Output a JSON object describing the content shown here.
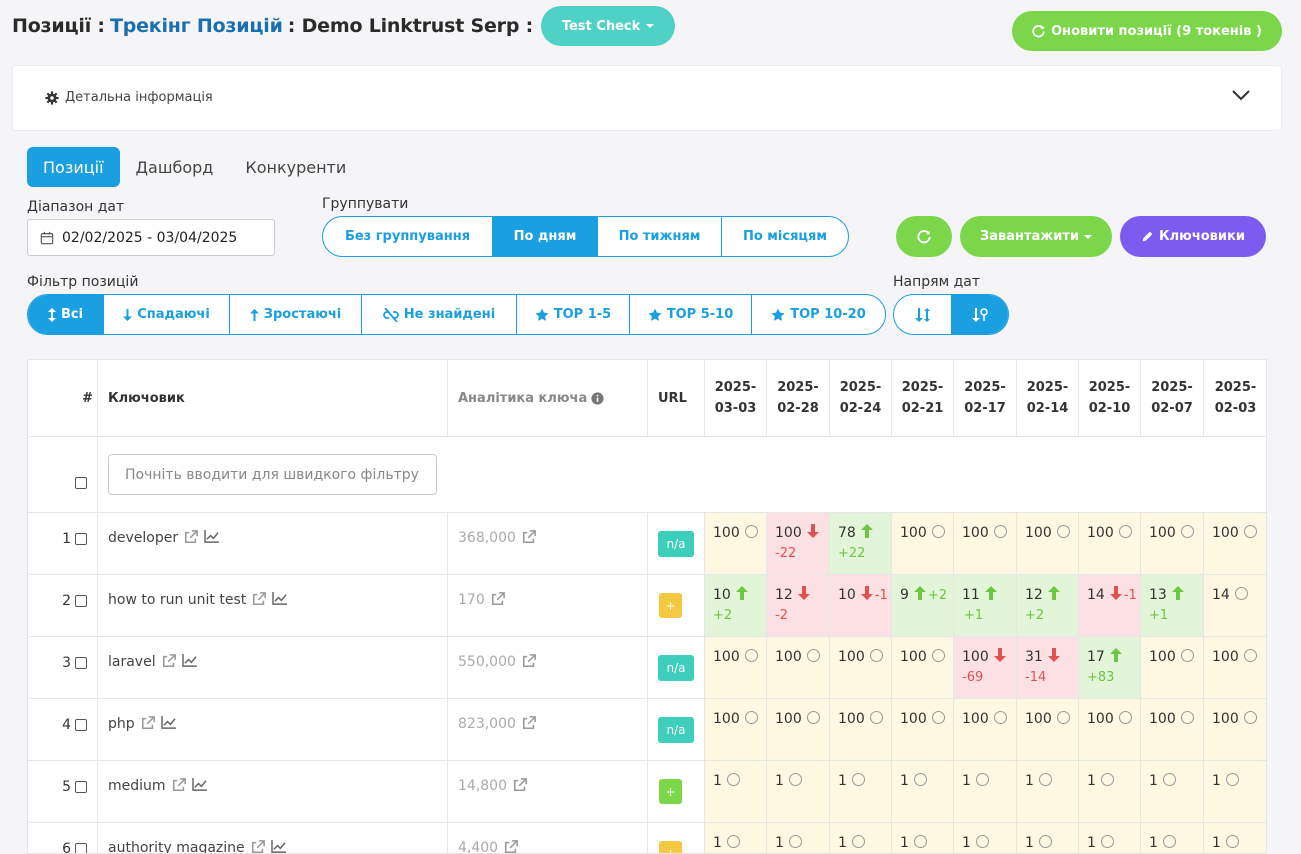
{
  "header": {
    "title1": "Позиції :",
    "title2": "Трекінг Позицій",
    "title3": ": Demo Linktrust Serp :",
    "project_btn": "Test Check",
    "update_btn": "Оновити позиції (9 токенів )"
  },
  "detail": {
    "label": "Детальна інформація"
  },
  "tabs": [
    "Позиції",
    "Дашборд",
    "Конкуренти"
  ],
  "date_range": {
    "label": "Діапазон дат",
    "value": "02/02/2025 - 03/04/2025"
  },
  "group": {
    "label": "Группувати",
    "options": [
      "Без группування",
      "По дням",
      "По тижням",
      "По місяцям"
    ],
    "active": 1
  },
  "actions": {
    "download": "Завантажити",
    "keywords": "Ключовики"
  },
  "filter": {
    "label": "Фільтр позицій",
    "options": [
      "Всі",
      "Спадаючі",
      "Зростаючі",
      "Не знайдені",
      "TOP 1-5",
      "TOP 5-10",
      "TOP 10-20"
    ],
    "active": 0
  },
  "direction": {
    "label": "Напрям дат"
  },
  "table": {
    "headers": {
      "num": "#",
      "keyword": "Ключовик",
      "analytics": "Аналітика ключа",
      "url": "URL"
    },
    "dates": [
      [
        "2025-",
        "03-03"
      ],
      [
        "2025-",
        "02-28"
      ],
      [
        "2025-",
        "02-24"
      ],
      [
        "2025-",
        "02-21"
      ],
      [
        "2025-",
        "02-17"
      ],
      [
        "2025-",
        "02-14"
      ],
      [
        "2025-",
        "02-10"
      ],
      [
        "2025-",
        "02-07"
      ],
      [
        "2025-",
        "02-03"
      ]
    ],
    "quick_filter_placeholder": "Почніть вводити для швидкого фільтру",
    "rows": [
      {
        "n": "1",
        "kw": "developer",
        "vol": "368,000",
        "url": "n/a",
        "urlc": "#3dcfbb",
        "pos": [
          [
            "100",
            "",
            ""
          ],
          [
            "100",
            "down",
            "-22"
          ],
          [
            "78",
            "up",
            "+22"
          ],
          [
            "100",
            "",
            ""
          ],
          [
            "100",
            "",
            ""
          ],
          [
            "100",
            "",
            ""
          ],
          [
            "100",
            "",
            ""
          ],
          [
            "100",
            "",
            ""
          ],
          [
            "100",
            "",
            ""
          ]
        ]
      },
      {
        "n": "2",
        "kw": "how to run unit test",
        "vol": "170",
        "url": "+",
        "urlc": "#f5c842",
        "pos": [
          [
            "10",
            "up",
            "+2"
          ],
          [
            "12",
            "down",
            "-2"
          ],
          [
            "10",
            "down",
            "-1",
            "i"
          ],
          [
            "9",
            "up",
            "+2",
            "i"
          ],
          [
            "11",
            "up",
            "+1",
            "i"
          ],
          [
            "12",
            "up",
            "+2"
          ],
          [
            "14",
            "down",
            "-1",
            "i"
          ],
          [
            "13",
            "up",
            "+1"
          ],
          [
            "14",
            "",
            ""
          ]
        ]
      },
      {
        "n": "3",
        "kw": "laravel",
        "vol": "550,000",
        "url": "n/a",
        "urlc": "#3dcfbb",
        "pos": [
          [
            "100",
            "",
            ""
          ],
          [
            "100",
            "",
            ""
          ],
          [
            "100",
            "",
            ""
          ],
          [
            "100",
            "",
            ""
          ],
          [
            "100",
            "down",
            "-69"
          ],
          [
            "31",
            "down",
            "-14"
          ],
          [
            "17",
            "up",
            "+83"
          ],
          [
            "100",
            "",
            ""
          ],
          [
            "100",
            "",
            ""
          ]
        ]
      },
      {
        "n": "4",
        "kw": "php",
        "vol": "823,000",
        "url": "n/a",
        "urlc": "#3dcfbb",
        "pos": [
          [
            "100",
            "",
            ""
          ],
          [
            "100",
            "",
            ""
          ],
          [
            "100",
            "",
            ""
          ],
          [
            "100",
            "",
            ""
          ],
          [
            "100",
            "",
            ""
          ],
          [
            "100",
            "",
            ""
          ],
          [
            "100",
            "",
            ""
          ],
          [
            "100",
            "",
            ""
          ],
          [
            "100",
            "",
            ""
          ]
        ]
      },
      {
        "n": "5",
        "kw": "medium",
        "vol": "14,800",
        "url": "+",
        "urlc": "#7bd64a",
        "pos": [
          [
            "1",
            "",
            ""
          ],
          [
            "1",
            "",
            ""
          ],
          [
            "1",
            "",
            ""
          ],
          [
            "1",
            "",
            ""
          ],
          [
            "1",
            "",
            ""
          ],
          [
            "1",
            "",
            ""
          ],
          [
            "1",
            "",
            ""
          ],
          [
            "1",
            "",
            ""
          ],
          [
            "1",
            "",
            ""
          ]
        ]
      },
      {
        "n": "6",
        "kw": "authority magazine",
        "vol": "4,400",
        "url": "+",
        "urlc": "#f5c842",
        "pos": [
          [
            "1",
            "",
            ""
          ],
          [
            "1",
            "",
            ""
          ],
          [
            "1",
            "",
            ""
          ],
          [
            "1",
            "",
            ""
          ],
          [
            "1",
            "",
            ""
          ],
          [
            "1",
            "",
            ""
          ],
          [
            "1",
            "",
            ""
          ],
          [
            "1",
            "",
            ""
          ],
          [
            "1",
            "",
            ""
          ]
        ]
      }
    ]
  },
  "colors": {
    "primary": "#1a9fe0",
    "teal": "#4fd1c5",
    "green": "#7bd64a",
    "purple": "#7c5cf0",
    "up": "#6cc644",
    "down": "#e05252"
  }
}
